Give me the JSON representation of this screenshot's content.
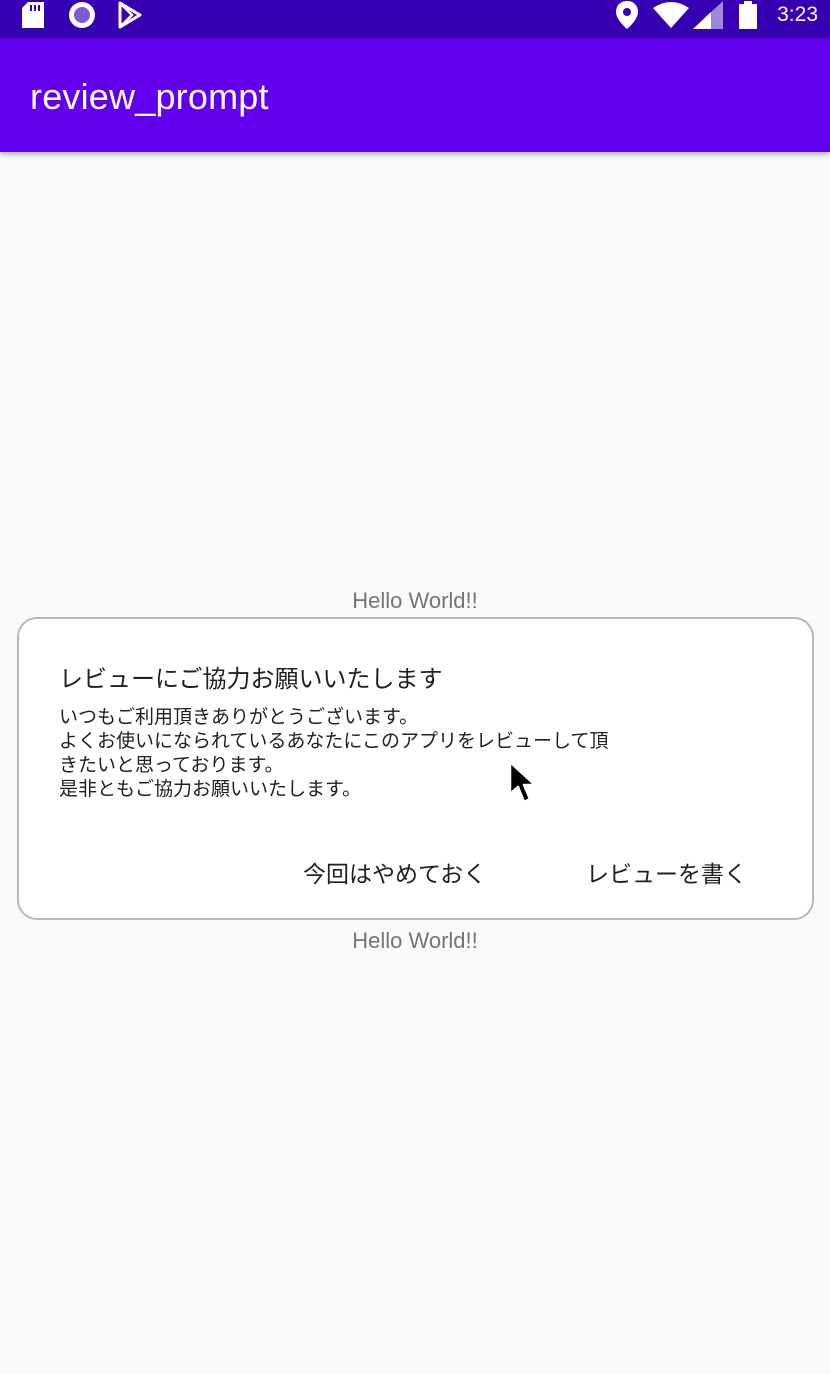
{
  "status_bar": {
    "time": "3:23",
    "icons_left": [
      "sd-card-icon",
      "circle-record-icon",
      "play-store-icon"
    ],
    "icons_right": [
      "location-pin-icon",
      "wifi-icon",
      "signal-icon",
      "battery-icon"
    ]
  },
  "app_bar": {
    "title": "review_prompt",
    "color": "#6200ee",
    "status_color": "#3700b3"
  },
  "content": {
    "hello_top": "Hello World!!",
    "hello_bottom": "Hello World!!"
  },
  "dialog": {
    "title": "レビューにご協力お願いいたします",
    "message_lines": [
      "いつもご利用頂きありがとうございます。",
      "よくお使いになられているあなたにこのアプリをレビューして頂",
      "きたいと思っております。",
      "是非ともご協力お願いいたします。"
    ],
    "negative_button": "今回はやめておく",
    "positive_button": "レビューを書く"
  }
}
